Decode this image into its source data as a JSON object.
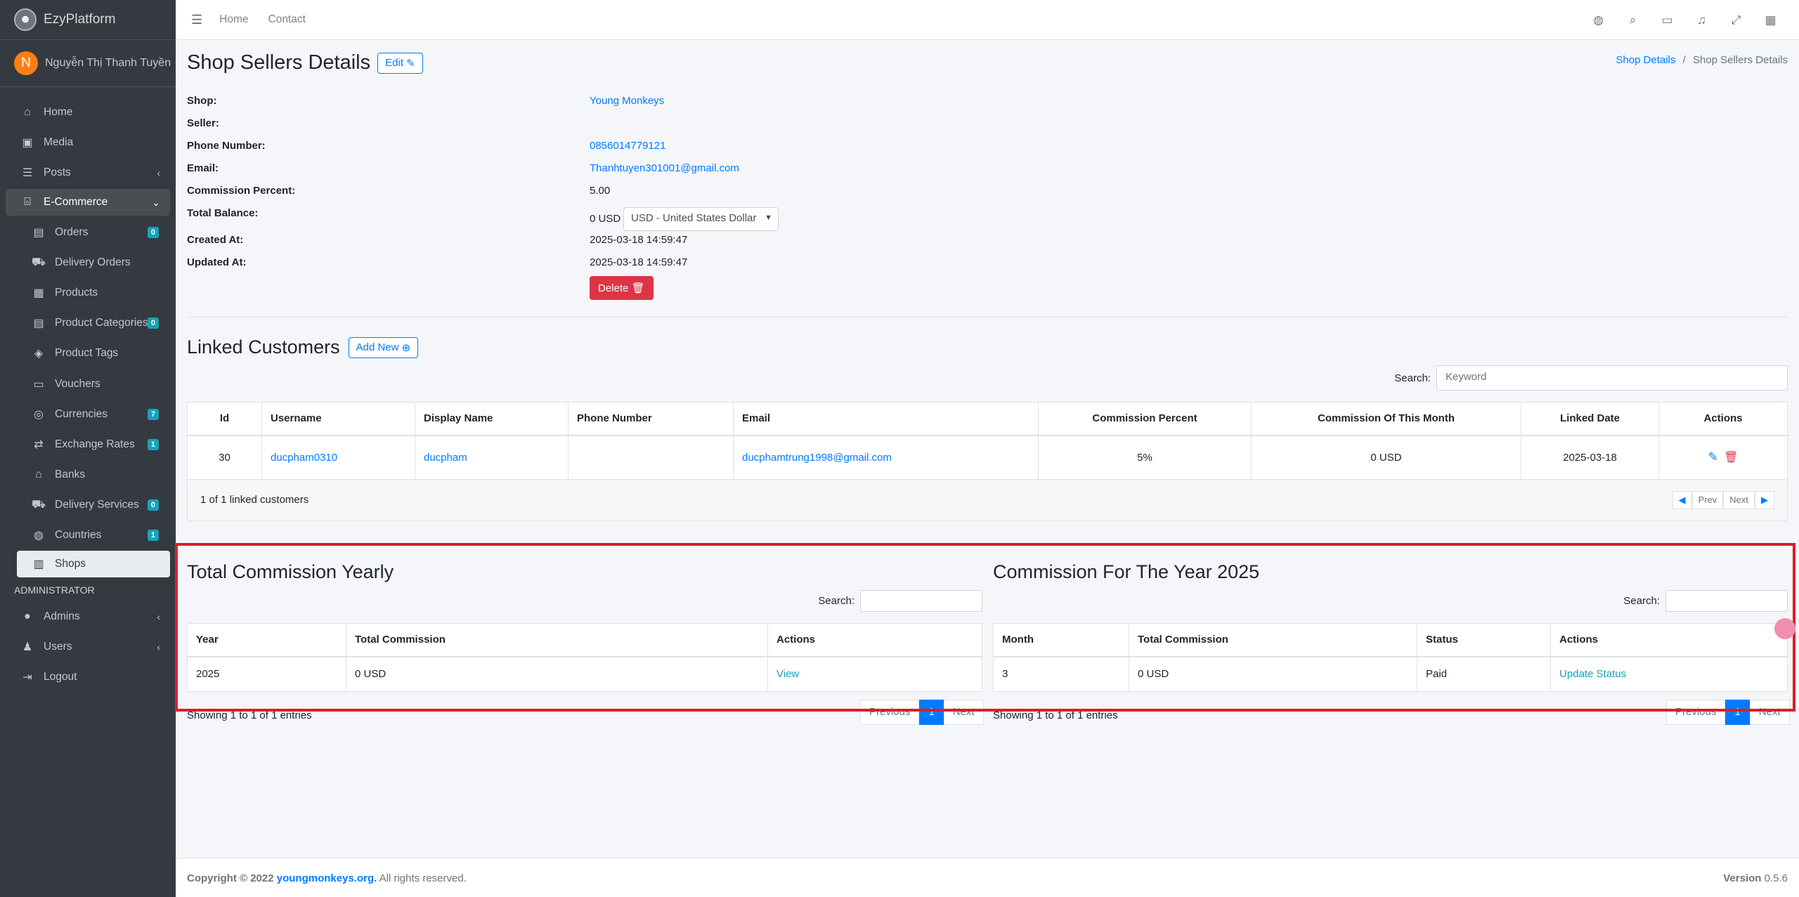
{
  "brand": {
    "name": "EzyPlatform"
  },
  "user": {
    "initial": "N",
    "name": "Nguyễn Thị Thanh Tuyền"
  },
  "sidebar": {
    "items_top": [
      {
        "label": "Home",
        "icon": "home-icon"
      },
      {
        "label": "Media",
        "icon": "image-icon"
      },
      {
        "label": "Posts",
        "icon": "list-icon"
      }
    ],
    "ecommerce": {
      "label": "E-Commerce"
    },
    "sub_items": [
      {
        "label": "Orders",
        "badge": "0"
      },
      {
        "label": "Delivery Orders",
        "badge": ""
      },
      {
        "label": "Products",
        "badge": ""
      },
      {
        "label": "Product Categories",
        "badge": "0"
      },
      {
        "label": "Product Tags",
        "badge": ""
      },
      {
        "label": "Vouchers",
        "badge": ""
      },
      {
        "label": "Currencies",
        "badge": "7"
      },
      {
        "label": "Exchange Rates",
        "badge": "1"
      },
      {
        "label": "Banks",
        "badge": ""
      },
      {
        "label": "Delivery Services",
        "badge": "0"
      },
      {
        "label": "Countries",
        "badge": "1"
      },
      {
        "label": "Shops",
        "badge": ""
      }
    ],
    "header_admin": "ADMINISTRATOR",
    "items_bottom": [
      {
        "label": "Admins"
      },
      {
        "label": "Users"
      },
      {
        "label": "Logout"
      }
    ]
  },
  "topbar": {
    "home": "Home",
    "contact": "Contact"
  },
  "page": {
    "title": "Shop Sellers Details",
    "edit_label": "Edit",
    "breadcrumb_parent": "Shop Details",
    "breadcrumb_sep": "/",
    "breadcrumb_current": "Shop Sellers Details"
  },
  "details": {
    "shop_label": "Shop:",
    "shop_value": "Young Monkeys",
    "seller_label": "Seller:",
    "phone_label": "Phone Number:",
    "phone_value": "0856014779121",
    "email_label": "Email:",
    "email_value": "Thanhtuyen301001@gmail.com",
    "commission_label": "Commission Percent:",
    "commission_value": "5.00",
    "balance_label": "Total Balance:",
    "balance_value": "0 USD",
    "currency_selected": "USD - United States Dollar",
    "created_label": "Created At:",
    "created_value": "2025-03-18 14:59:47",
    "updated_label": "Updated At:",
    "updated_value": "2025-03-18 14:59:47",
    "delete_label": "Delete"
  },
  "linked": {
    "title": "Linked Customers",
    "add_label": "Add New",
    "search_label": "Search:",
    "search_placeholder": "Keyword",
    "headers": [
      "Id",
      "Username",
      "Display Name",
      "Phone Number",
      "Email",
      "Commission Percent",
      "Commission Of This Month",
      "Linked Date",
      "Actions"
    ],
    "row": {
      "id": "30",
      "username": "ducpham0310",
      "display_name": "ducpham",
      "phone": "",
      "email": "ducphamtrung1998@gmail.com",
      "commission_percent": "5%",
      "commission_month": "0 USD",
      "linked_date": "2025-03-18"
    },
    "count_text": "1 of 1 linked customers",
    "prev": "Prev",
    "next": "Next"
  },
  "yearly": {
    "title": "Total Commission Yearly",
    "search_label": "Search:",
    "headers": [
      "Year",
      "Total Commission",
      "Actions"
    ],
    "row": {
      "year": "2025",
      "total": "0 USD",
      "action": "View"
    },
    "info": "Showing 1 to 1 of 1 entries",
    "previous": "Previous",
    "page": "1",
    "next": "Next"
  },
  "monthly": {
    "title": "Commission For The Year 2025",
    "search_label": "Search:",
    "headers": [
      "Month",
      "Total Commission",
      "Status",
      "Actions"
    ],
    "row": {
      "month": "3",
      "total": "0 USD",
      "status": "Paid",
      "action": "Update Status"
    },
    "info": "Showing 1 to 1 of 1 entries",
    "previous": "Previous",
    "page": "1",
    "next": "Next"
  },
  "footer": {
    "copyright": "Copyright © 2022",
    "site": "youngmonkeys.org.",
    "rights": "All rights reserved.",
    "version_label": "Version",
    "version": "0.5.6"
  },
  "colors": {
    "primary": "#007bff",
    "danger": "#dc3545",
    "sidebar": "#343a40",
    "highlight": "#dc1e2a"
  }
}
